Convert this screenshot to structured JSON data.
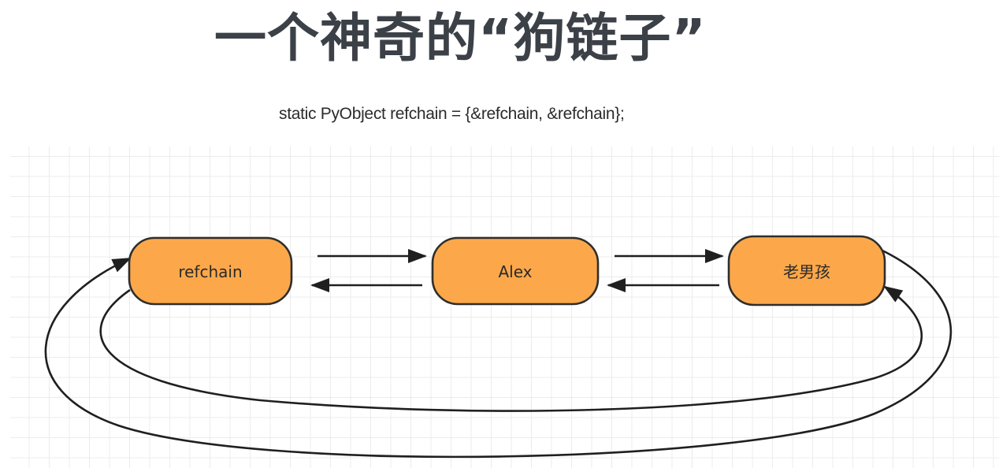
{
  "title": "一个神奇的“狗链子”",
  "code": "static PyObject refchain = {&refchain, &refchain};",
  "nodes": {
    "refchain": "refchain",
    "alex": "Alex",
    "oldboy": "老男孩"
  },
  "colors": {
    "node_fill": "#fca84a",
    "node_stroke": "#2e2e2e",
    "arrow": "#1f1f1f",
    "title": "#3c4148"
  }
}
